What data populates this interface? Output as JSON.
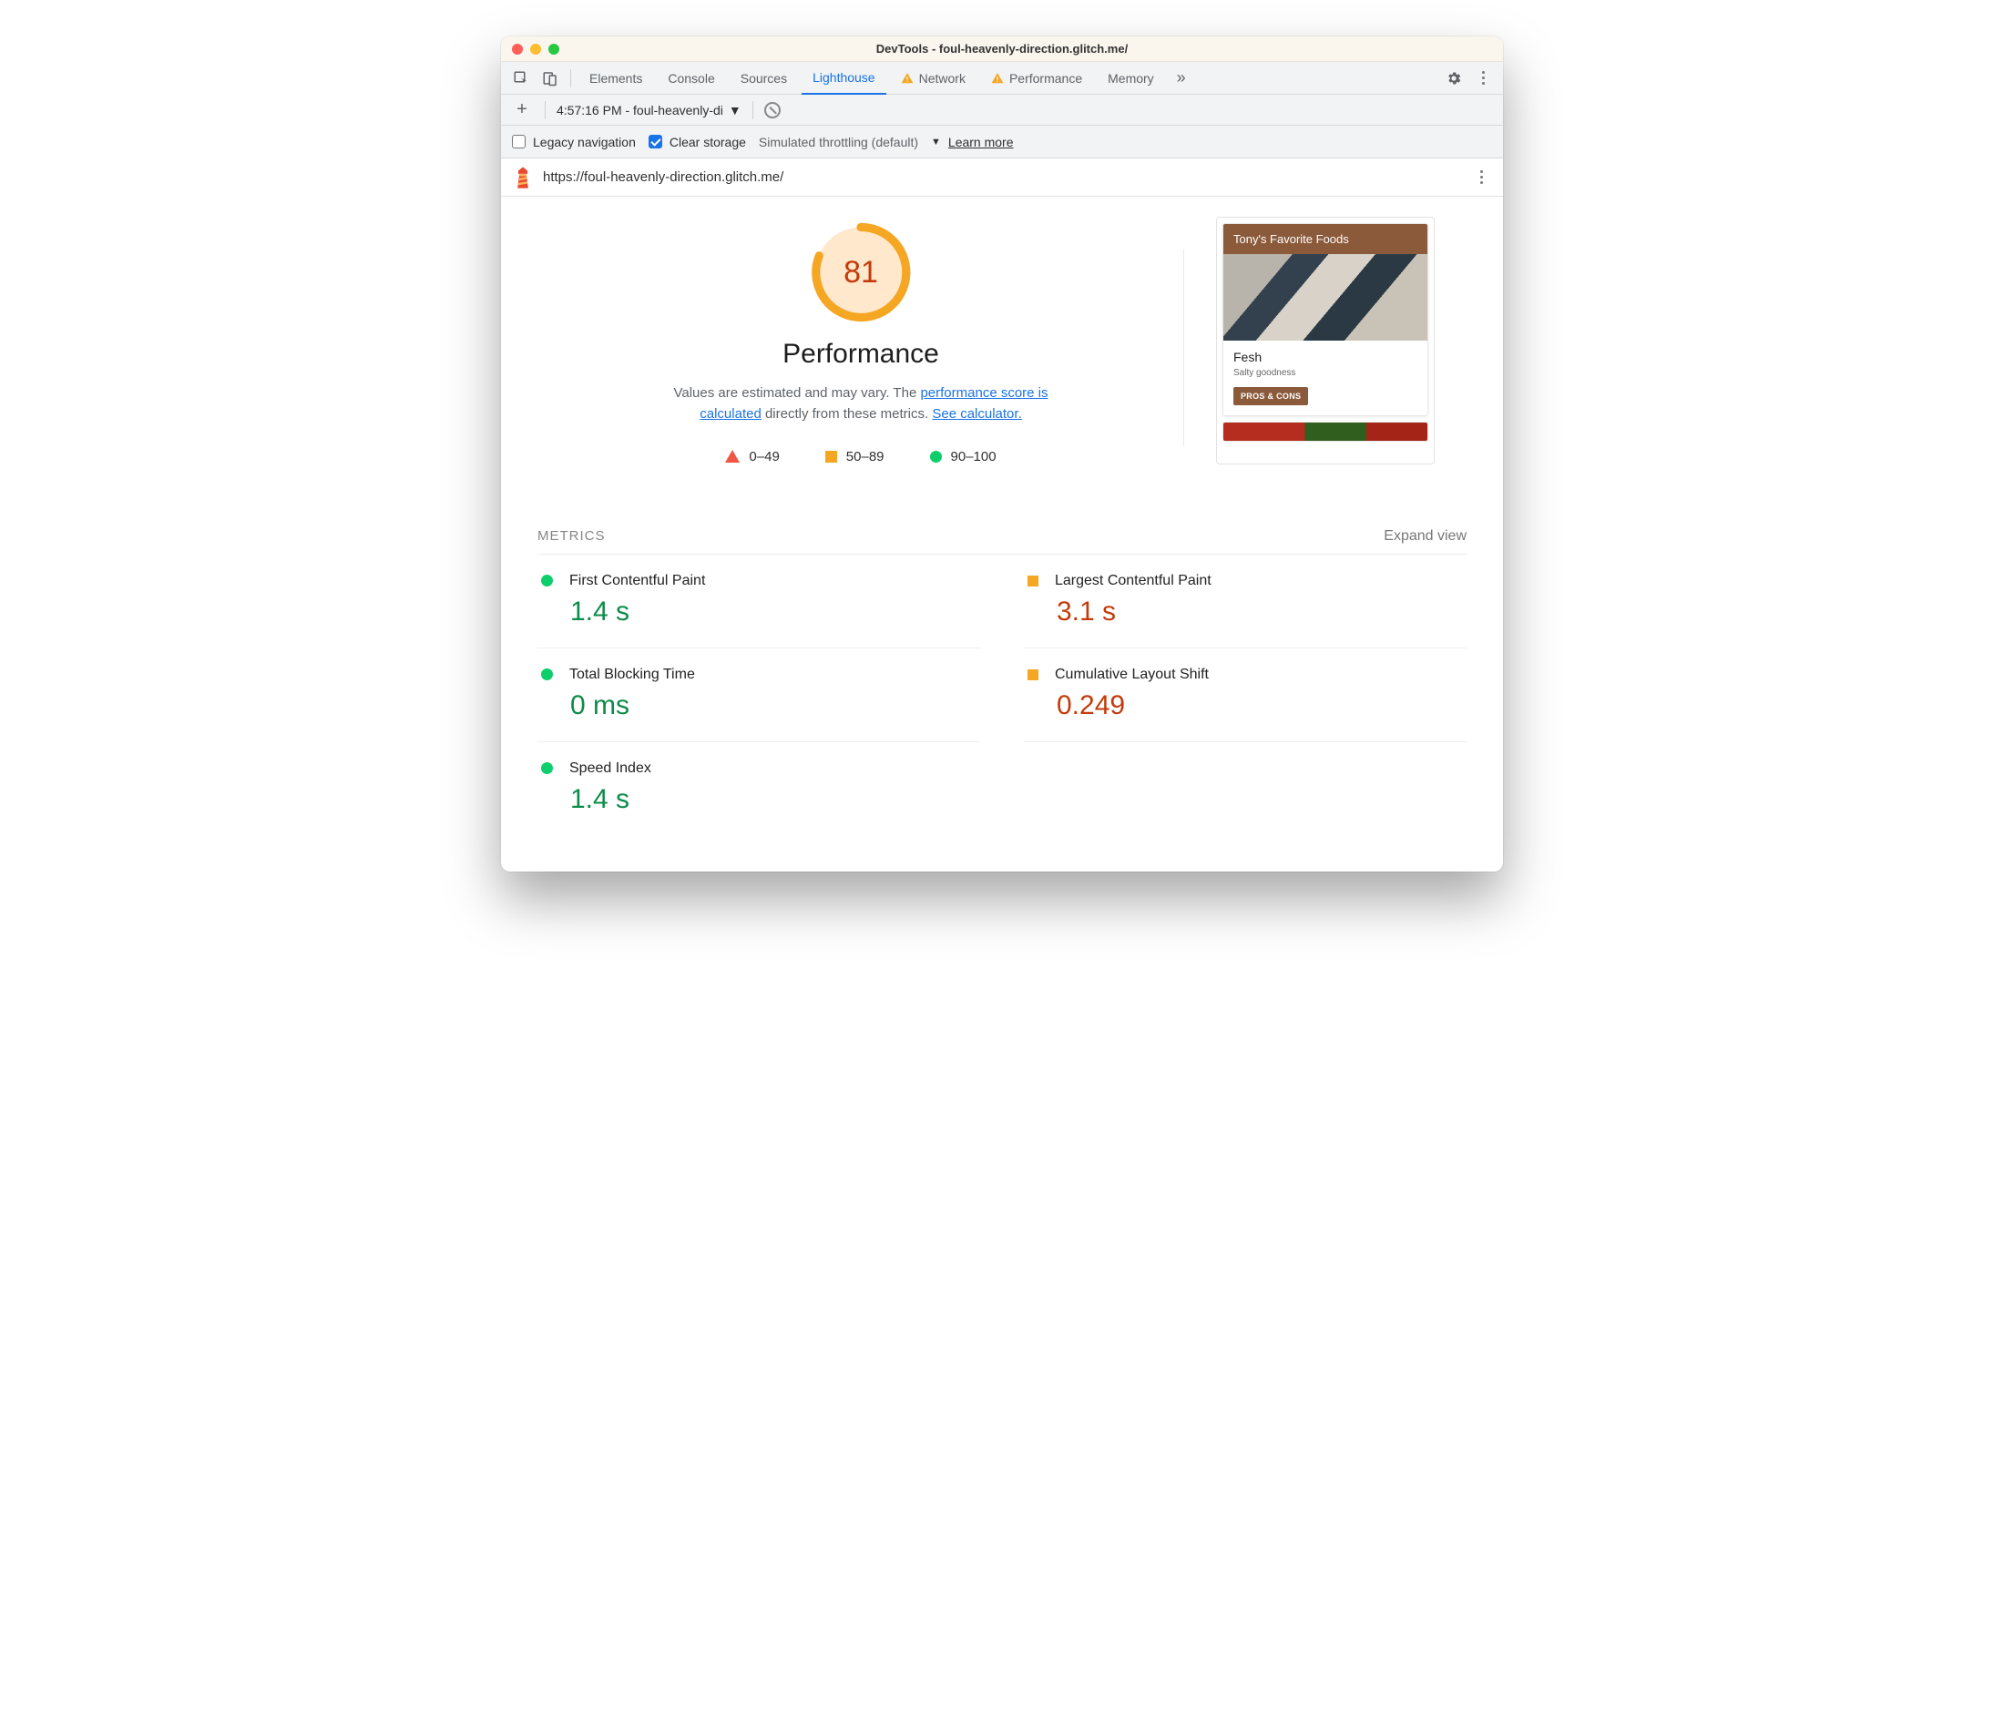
{
  "window": {
    "title": "DevTools - foul-heavenly-direction.glitch.me/"
  },
  "tabs": {
    "elements": "Elements",
    "console": "Console",
    "sources": "Sources",
    "lighthouse": "Lighthouse",
    "network": "Network",
    "performance": "Performance",
    "memory": "Memory"
  },
  "subbar": {
    "report_label": "4:57:16 PM - foul-heavenly-di"
  },
  "options": {
    "legacy": "Legacy navigation",
    "clear": "Clear storage",
    "throttle": "Simulated throttling (default)",
    "learn": "Learn more"
  },
  "urlbar": {
    "url": "https://foul-heavenly-direction.glitch.me/"
  },
  "gauge": {
    "score": "81"
  },
  "hero": {
    "title": "Performance",
    "desc_a": "Values are estimated and may vary. The ",
    "link1": "performance score is calculated",
    "desc_b": " directly from these metrics. ",
    "link2": "See calculator."
  },
  "legend": {
    "r1": "0–49",
    "r2": "50–89",
    "r3": "90–100"
  },
  "thumb": {
    "header": "Tony's Favorite Foods",
    "card_title": "Fesh",
    "card_sub": "Salty goodness",
    "badge": "PROS & CONS"
  },
  "metrics_header": {
    "title": "METRICS",
    "expand": "Expand view"
  },
  "metrics": {
    "fcp": {
      "label": "First Contentful Paint",
      "value": "1.4 s"
    },
    "lcp": {
      "label": "Largest Contentful Paint",
      "value": "3.1 s"
    },
    "tbt": {
      "label": "Total Blocking Time",
      "value": "0 ms"
    },
    "cls": {
      "label": "Cumulative Layout Shift",
      "value": "0.249"
    },
    "si": {
      "label": "Speed Index",
      "value": "1.4 s"
    }
  },
  "chart_data": {
    "type": "table",
    "title": "Lighthouse Performance Metrics",
    "score": 81,
    "score_ranges": [
      {
        "label": "0–49",
        "status": "fail"
      },
      {
        "label": "50–89",
        "status": "average"
      },
      {
        "label": "90–100",
        "status": "pass"
      }
    ],
    "series": [
      {
        "name": "First Contentful Paint",
        "value": "1.4 s",
        "status": "pass"
      },
      {
        "name": "Largest Contentful Paint",
        "value": "3.1 s",
        "status": "average"
      },
      {
        "name": "Total Blocking Time",
        "value": "0 ms",
        "status": "pass"
      },
      {
        "name": "Cumulative Layout Shift",
        "value": "0.249",
        "status": "average"
      },
      {
        "name": "Speed Index",
        "value": "1.4 s",
        "status": "pass"
      }
    ]
  }
}
